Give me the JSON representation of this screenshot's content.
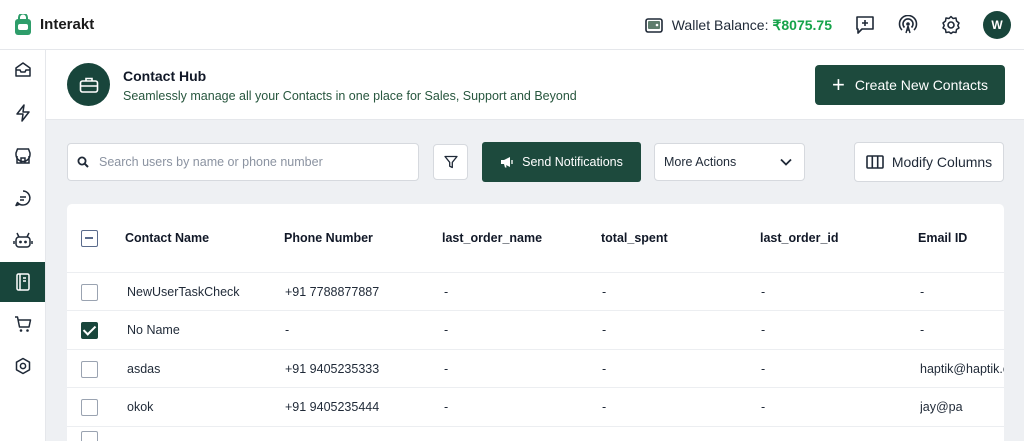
{
  "app": {
    "name": "Interakt"
  },
  "wallet": {
    "label": "Wallet Balance:",
    "amount": "₹8075.75"
  },
  "user": {
    "initial": "W"
  },
  "sidebar": {
    "items": [
      {
        "icon": "inbox-icon"
      },
      {
        "icon": "lightning-icon"
      },
      {
        "icon": "store-icon"
      },
      {
        "icon": "chat-icon"
      },
      {
        "icon": "bot-icon"
      },
      {
        "icon": "contacts-book-icon",
        "active": true
      },
      {
        "icon": "cart-icon"
      },
      {
        "icon": "settings-hex-icon"
      }
    ]
  },
  "hub": {
    "title": "Contact Hub",
    "subtitle": "Seamlessly manage all your Contacts in one place for Sales, Support and Beyond",
    "create_label": "Create New Contacts",
    "create_plus": "+"
  },
  "toolbar": {
    "search_placeholder": "Search users by name or phone number",
    "send_label": "Send Notifications",
    "more_label": "More Actions",
    "modify_label": "Modify Columns"
  },
  "table": {
    "columns": [
      "Contact Name",
      "Phone Number",
      "last_order_name",
      "total_spent",
      "last_order_id",
      "Email ID"
    ],
    "rows": [
      {
        "checked": false,
        "cells": [
          "NewUserTaskCheck",
          "+91 7788877887",
          "-",
          "-",
          "-",
          "-"
        ]
      },
      {
        "checked": true,
        "cells": [
          "No Name",
          "-",
          "-",
          "-",
          "-",
          "-"
        ]
      },
      {
        "checked": false,
        "cells": [
          "asdas",
          "+91 9405235333",
          "-",
          "-",
          "-",
          "haptik@haptik.co"
        ]
      },
      {
        "checked": false,
        "cells": [
          "okok",
          "+91 9405235444",
          "-",
          "-",
          "-",
          "jay@pa"
        ]
      }
    ]
  },
  "colors": {
    "brand": "#18453b",
    "wallet_amount": "#16a34a"
  }
}
